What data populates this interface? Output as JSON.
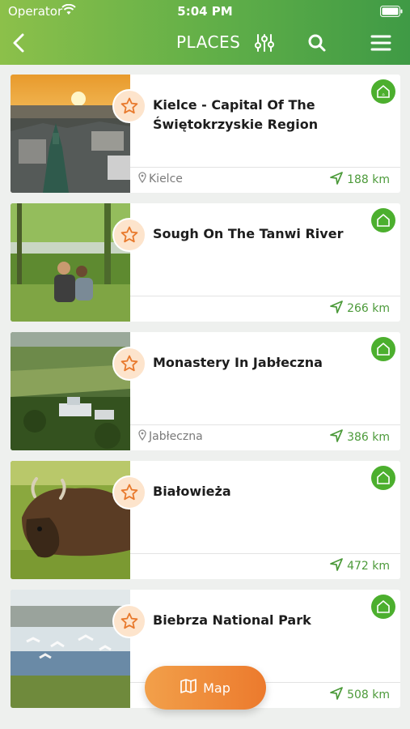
{
  "status_bar": {
    "carrier": "Operator",
    "time": "5:04 PM"
  },
  "nav": {
    "title": "PLACES",
    "back_icon": "chevron-left-icon",
    "filter_icon": "sliders-icon",
    "search_icon": "search-icon",
    "menu_icon": "hamburger-menu-icon"
  },
  "colors": {
    "header_start": "#8cc04a",
    "header_end": "#3f9a45",
    "accent_green": "#4caf2e",
    "distance_green": "#4c9a3a",
    "map_button": "#ec7a2d",
    "favorite_bg": "#fde4cc"
  },
  "places": [
    {
      "title": "Kielce - Capital Of The Świętokrzyskie Region",
      "location": "Kielce",
      "distance": "188 km",
      "image": "sunset-town"
    },
    {
      "title": "Sough On The Tanwi River",
      "location": "",
      "distance": "266 km",
      "image": "couple-by-river"
    },
    {
      "title": "Monastery In Jabłeczna",
      "location": "Jabłeczna",
      "distance": "386 km",
      "image": "aerial-monastery"
    },
    {
      "title": "Białowieża",
      "location": "",
      "distance": "472 km",
      "image": "bison"
    },
    {
      "title": "Biebrza National Park",
      "location": "",
      "distance": "508 km",
      "image": "birds-wetland"
    }
  ],
  "map_button": {
    "label": "Map",
    "icon": "map-icon"
  }
}
